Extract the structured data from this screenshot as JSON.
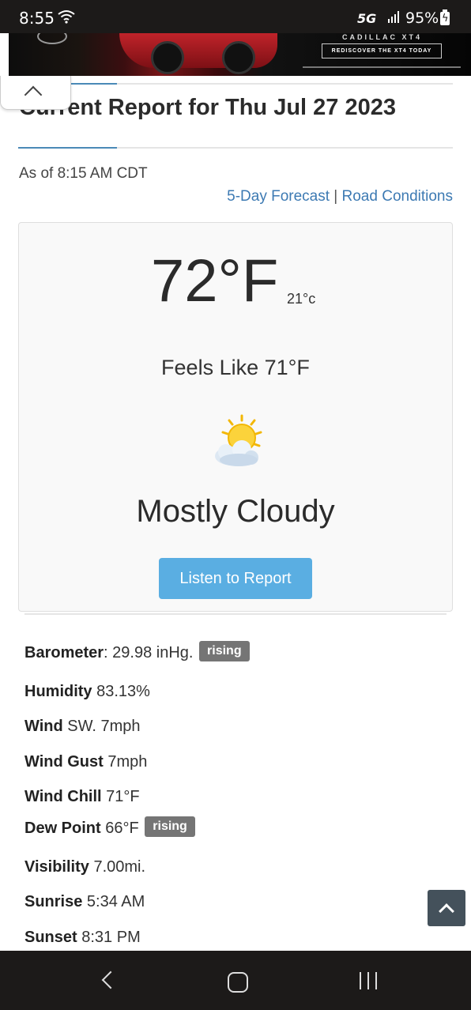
{
  "status_bar": {
    "time": "8:55",
    "network": "5G",
    "battery": "95%"
  },
  "ad": {
    "brand": "CADILLAC XT4",
    "cta": "REDISCOVER THE XT4 TODAY"
  },
  "report": {
    "title": "Current Report for Thu Jul 27 2023",
    "as_of": "As of 8:15 AM CDT",
    "forecast_link": "5-Day Forecast",
    "separator": "|",
    "road_link": "Road Conditions"
  },
  "current": {
    "temp_f": "72°F",
    "temp_c": "21°c",
    "feels_like": "Feels Like 71°F",
    "icon": "partly-cloudy-sun-icon",
    "condition": "Mostly Cloudy",
    "listen_button": "Listen to Report"
  },
  "details": [
    {
      "label": "Barometer",
      "sep": ": ",
      "value": "29.98 inHg.",
      "badge": "rising"
    },
    {
      "label": "Humidity",
      "sep": " ",
      "value": "83.13%",
      "badge": ""
    },
    {
      "label": "Wind",
      "sep": " ",
      "value": "SW. 7mph",
      "badge": ""
    },
    {
      "label": "Wind Gust",
      "sep": " ",
      "value": "7mph",
      "badge": ""
    },
    {
      "label": "Wind Chill",
      "sep": " ",
      "value": "71°F",
      "badge": ""
    },
    {
      "label": "Dew Point",
      "sep": " ",
      "value": "66°F",
      "badge": "rising"
    },
    {
      "label": "Visibility",
      "sep": " ",
      "value": "7.00mi.",
      "badge": ""
    },
    {
      "label": "Sunrise",
      "sep": " ",
      "value": "5:34 AM",
      "badge": ""
    },
    {
      "label": "Sunset",
      "sep": " ",
      "value": "8:31 PM",
      "badge": ""
    }
  ],
  "colors": {
    "accent": "#4a8ab7",
    "link": "#3d7ab3",
    "button": "#5aaee2",
    "badge": "#757575"
  }
}
